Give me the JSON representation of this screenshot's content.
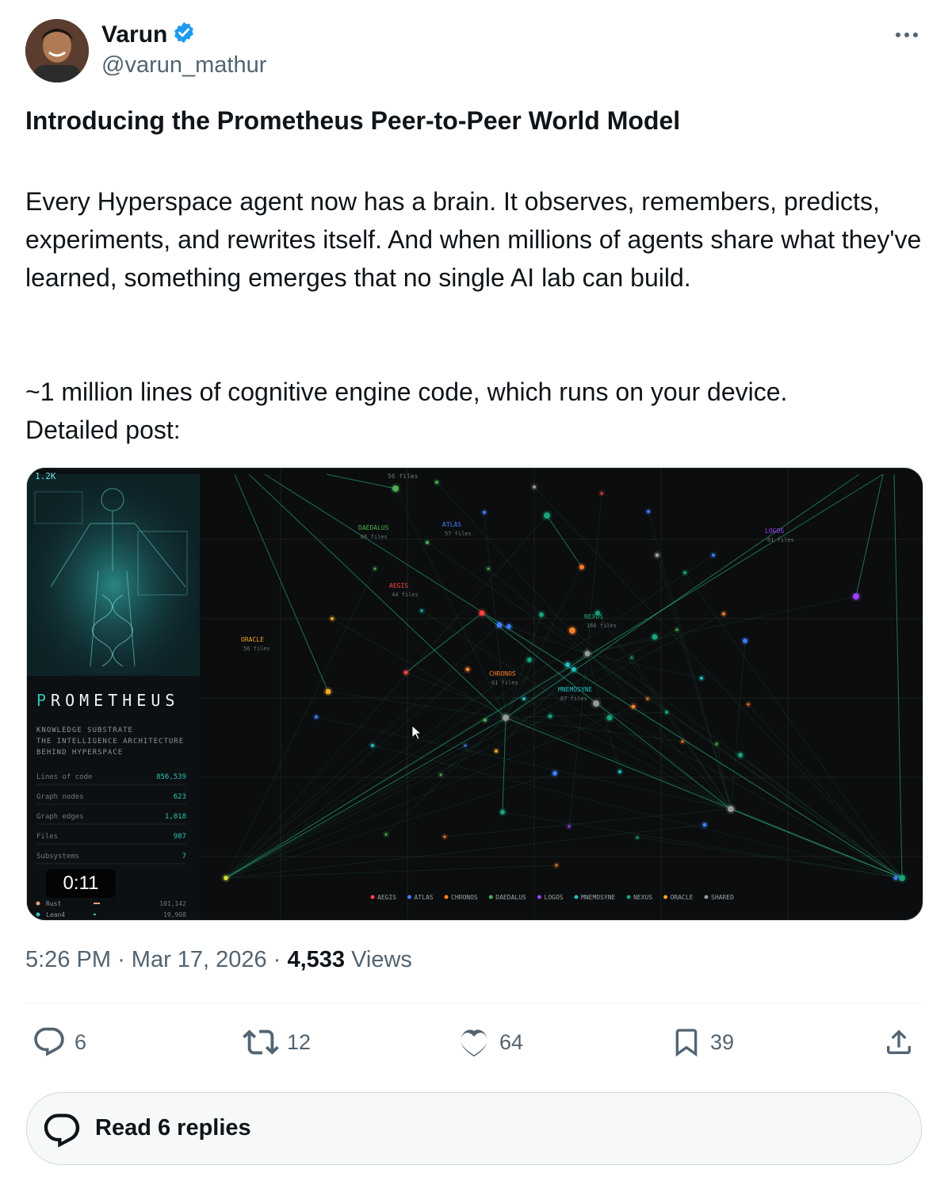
{
  "author": {
    "name": "Varun",
    "handle": "@varun_mathur",
    "verified": true
  },
  "tweet": {
    "title": "Introducing the Prometheus Peer-to-Peer World Model",
    "paragraph1": "Every Hyperspace agent now has a brain. It observes, remembers, predicts, experiments, and rewrites itself. And when millions of agents share what they've learned, something emerges that no single AI lab can build.",
    "paragraph2_line1": "~1 million lines of cognitive engine code, which runs on your device.",
    "paragraph2_line2": "Detailed post:"
  },
  "video": {
    "duration": "0:11",
    "panel": {
      "brand": "PROMETHEUS",
      "tagline1": "KNOWLEDGE SUBSTRATE",
      "tagline2": "THE INTELLIGENCE ARCHITECTURE",
      "tagline3": "BEHIND HYPERSPACE",
      "stats": [
        {
          "label": "Lines of code",
          "value": "856,539"
        },
        {
          "label": "Graph nodes",
          "value": "623"
        },
        {
          "label": "Graph edges",
          "value": "1,018"
        },
        {
          "label": "Files",
          "value": "987"
        },
        {
          "label": "Subsystems",
          "value": "7"
        }
      ],
      "languages": [
        {
          "name": "Rust",
          "value": "101,142",
          "color": "#f0a080"
        },
        {
          "name": "Lean4",
          "value": "19,908",
          "color": "#2ec4b6"
        }
      ],
      "top_count": "1.2K"
    },
    "clusters": [
      {
        "name": "DAEDALUS",
        "files": "66 files",
        "color": "#4caf50"
      },
      {
        "name": "ATLAS",
        "files": "57 files",
        "color": "#3f7fff"
      },
      {
        "name": "LOGOS",
        "files": "61 files",
        "color": "#a040ff"
      },
      {
        "name": "AEGIS",
        "files": "44 files",
        "color": "#ff4040"
      },
      {
        "name": "NEXUS",
        "files": "166 files",
        "color": "#1aa37a"
      },
      {
        "name": "ORACLE",
        "files": "56 files",
        "color": "#f5a623"
      },
      {
        "name": "CHRONOS",
        "files": "61 files",
        "color": "#ff7f27"
      },
      {
        "name": "MNEMOSYNE",
        "files": "67 files",
        "color": "#20c0c0"
      }
    ],
    "top_label": "56 files",
    "legend": [
      {
        "name": "AEGIS",
        "color": "#ff4040"
      },
      {
        "name": "ATLAS",
        "color": "#3f7fff"
      },
      {
        "name": "CHRONOS",
        "color": "#ff7f27"
      },
      {
        "name": "DAEDALUS",
        "color": "#4caf50"
      },
      {
        "name": "LOGOS",
        "color": "#a040ff"
      },
      {
        "name": "MNEMOSYNE",
        "color": "#20c0c0"
      },
      {
        "name": "NEXUS",
        "color": "#1aa37a"
      },
      {
        "name": "ORACLE",
        "color": "#f5a623"
      },
      {
        "name": "SHARED",
        "color": "#9a9a9a"
      }
    ]
  },
  "meta": {
    "time": "5:26 PM",
    "date": "Mar 17, 2026",
    "views_count": "4,533",
    "views_label": "Views"
  },
  "actions": {
    "replies": "6",
    "reposts": "12",
    "likes": "64",
    "bookmarks": "39"
  },
  "read_replies": "Read 6 replies"
}
